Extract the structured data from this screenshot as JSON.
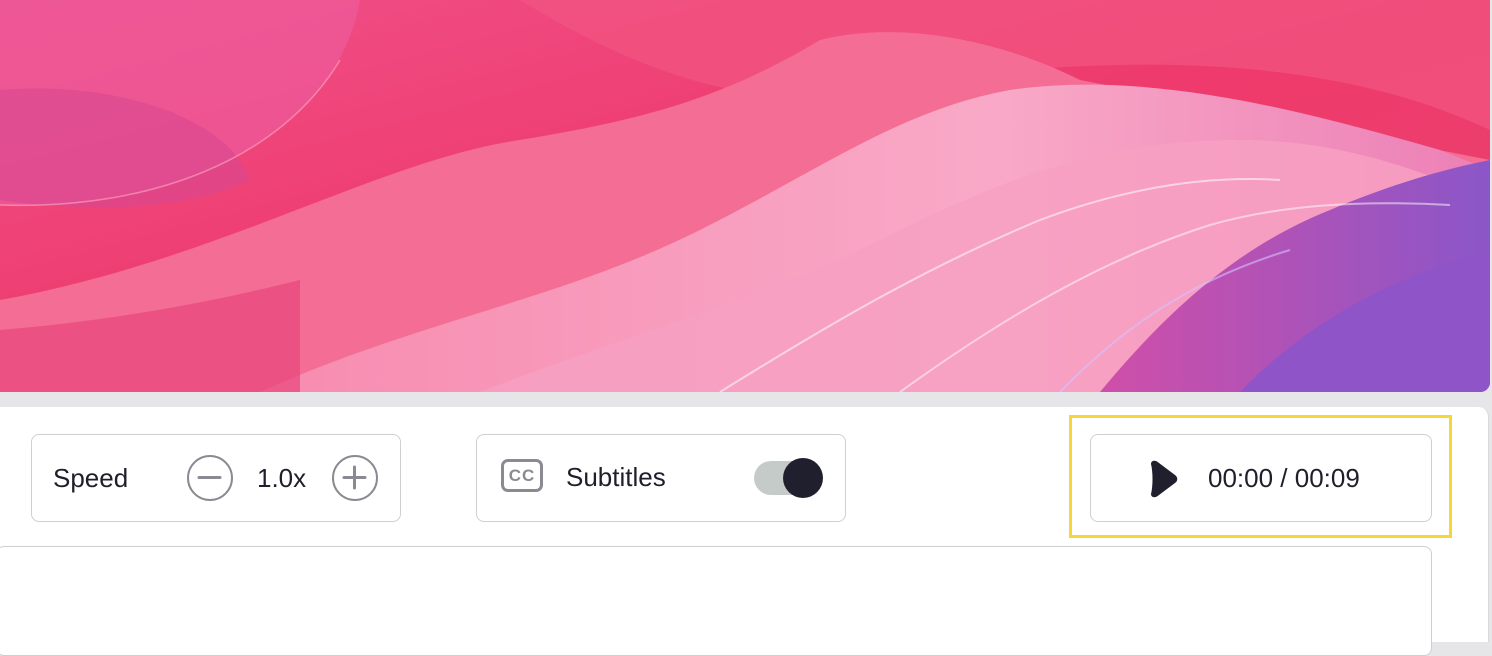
{
  "preview": {
    "colors": {
      "base": "#f0417a",
      "pink_light": "#f7a6c6",
      "purple": "#8e55c6"
    }
  },
  "controls": {
    "speed": {
      "label": "Speed",
      "value": "1.0x",
      "decrease_icon": "minus-circle-icon",
      "increase_icon": "plus-circle-icon"
    },
    "subtitles": {
      "icon": "closed-captions-icon",
      "icon_text": "CC",
      "label": "Subtitles",
      "enabled": true
    },
    "playback": {
      "icon": "play-icon",
      "time": "00:00 / 00:09"
    }
  },
  "colors": {
    "text": "#1e1f2b",
    "border": "#cfcfd3",
    "highlight": "#f5d736",
    "toggle_knob": "#1f1f2e",
    "toggle_track": "#c5cbc9"
  }
}
